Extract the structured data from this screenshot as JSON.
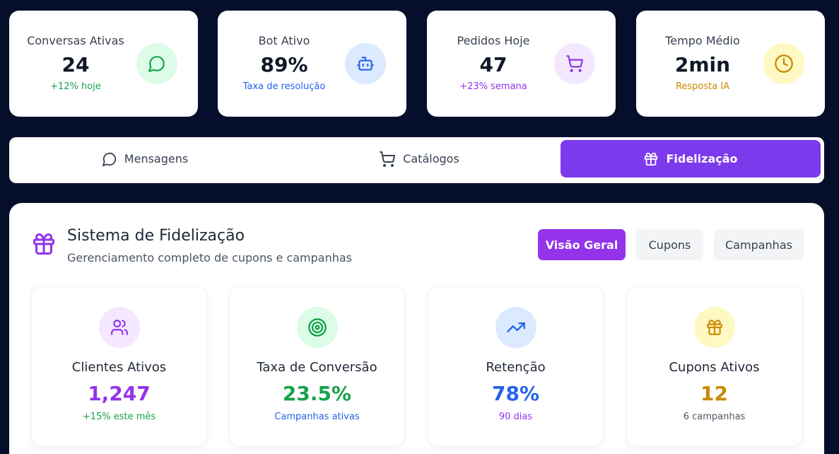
{
  "kpis": [
    {
      "title": "Conversas Ativas",
      "value": "24",
      "sub": "+12% hoje",
      "sub_color": "#16a34a",
      "icon": "message-circle-icon",
      "icon_color": "#16a34a",
      "icon_bg": "#dcfce7"
    },
    {
      "title": "Bot Ativo",
      "value": "89%",
      "sub": "Taxa de resolução",
      "sub_color": "#2563eb",
      "icon": "bot-icon",
      "icon_color": "#2563eb",
      "icon_bg": "#dbeafe"
    },
    {
      "title": "Pedidos Hoje",
      "value": "47",
      "sub": "+23% semana",
      "sub_color": "#9333ea",
      "icon": "shopping-cart-icon",
      "icon_color": "#9333ea",
      "icon_bg": "#f3e8ff"
    },
    {
      "title": "Tempo Médio",
      "value": "2min",
      "sub": "Resposta IA",
      "sub_color": "#ca8a04",
      "icon": "clock-icon",
      "icon_color": "#ca8a04",
      "icon_bg": "#fef9c3"
    }
  ],
  "tabs": [
    {
      "label": "Mensagens",
      "icon": "message-circle-icon",
      "active": false
    },
    {
      "label": "Catálogos",
      "icon": "shopping-cart-icon",
      "active": false
    },
    {
      "label": "Fidelização",
      "icon": "gift-icon",
      "active": true
    }
  ],
  "loyalty": {
    "title": "Sistema de Fidelização",
    "subtitle": "Gerenciamento completo de cupons e campanhas",
    "icon": "gift-icon",
    "segments": [
      {
        "label": "Visão Geral",
        "active": true
      },
      {
        "label": "Cupons",
        "active": false
      },
      {
        "label": "Campanhas",
        "active": false
      }
    ],
    "stats": [
      {
        "title": "Clientes Ativos",
        "value": "1,247",
        "sub": "+15% este mês",
        "value_color": "#9333ea",
        "sub_color": "#16a34a",
        "icon": "users-icon",
        "icon_color": "#9333ea",
        "icon_bg": "#f3e8ff"
      },
      {
        "title": "Taxa de Conversão",
        "value": "23.5%",
        "sub": "Campanhas ativas",
        "value_color": "#16a34a",
        "sub_color": "#2563eb",
        "icon": "target-icon",
        "icon_color": "#16a34a",
        "icon_bg": "#dcfce7"
      },
      {
        "title": "Retenção",
        "value": "78%",
        "sub": "90 dias",
        "value_color": "#2563eb",
        "sub_color": "#9333ea",
        "icon": "trending-up-icon",
        "icon_color": "#2563eb",
        "icon_bg": "#dbeafe"
      },
      {
        "title": "Cupons Ativos",
        "value": "12",
        "sub": "6 campanhas",
        "value_color": "#ca8a04",
        "sub_color": "#4b5563",
        "icon": "gift-icon",
        "icon_color": "#ca8a04",
        "icon_bg": "#fef9c3"
      }
    ]
  },
  "colors": {
    "page_bg": "#050f2c",
    "accent": "#7c3aed",
    "accent_segment": "#9333ea"
  }
}
